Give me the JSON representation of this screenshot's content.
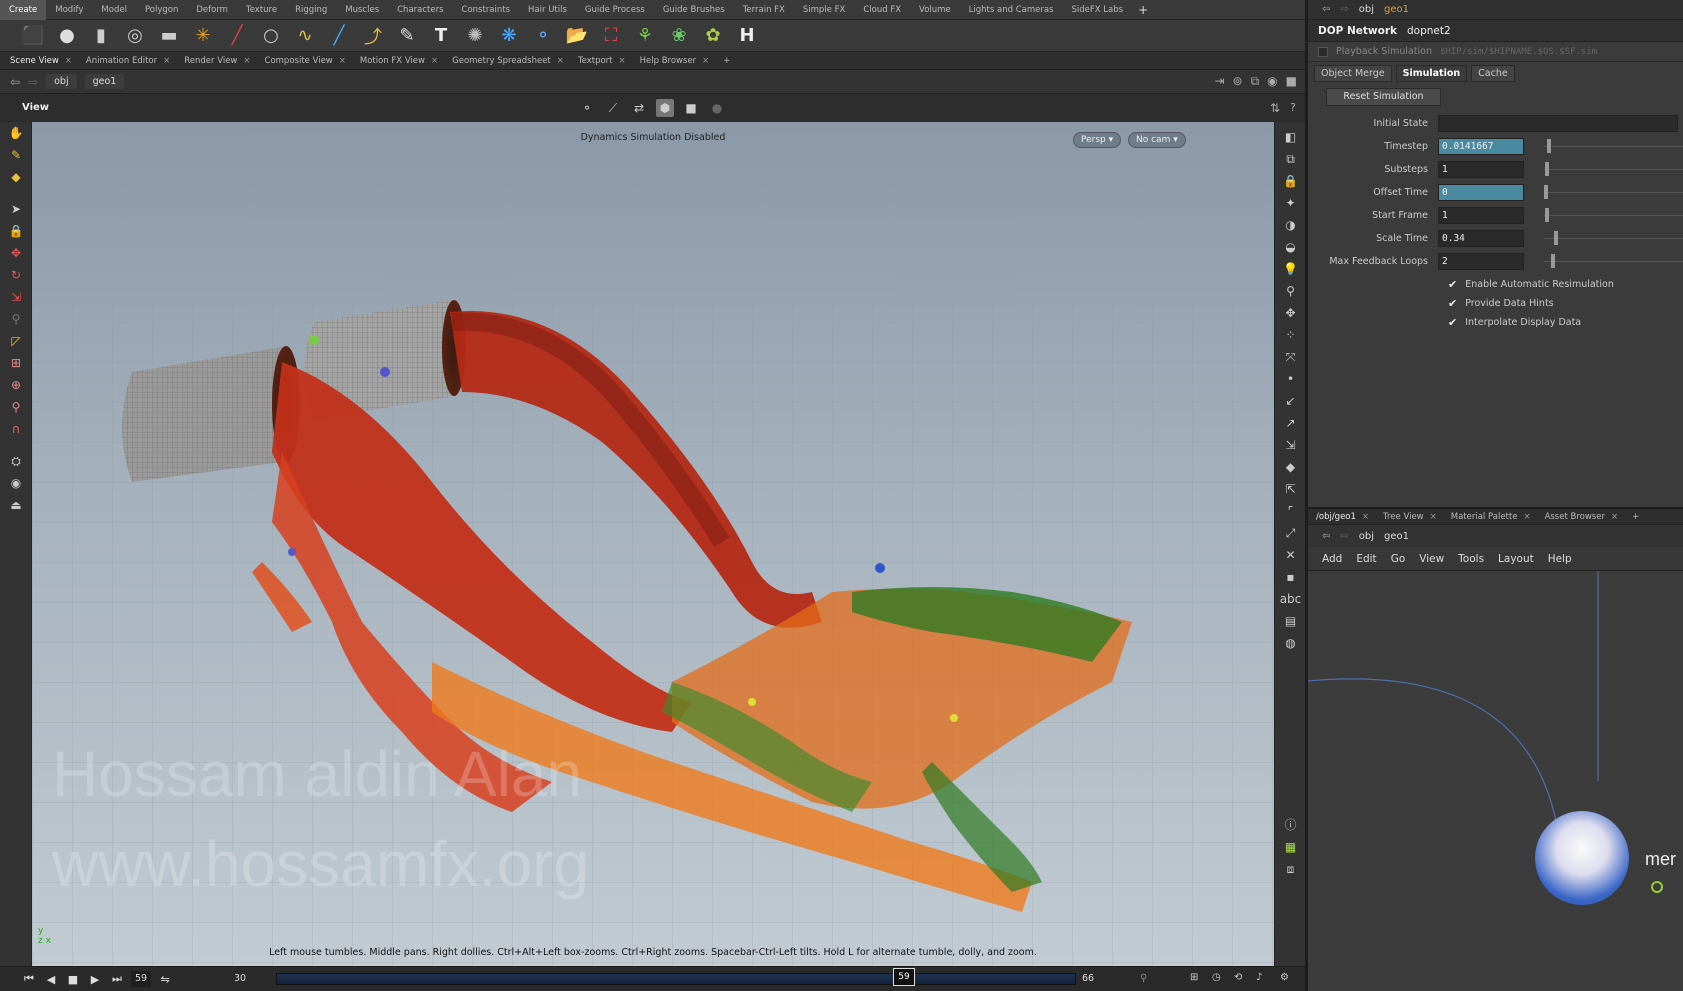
{
  "shelf": {
    "tabs": [
      "Create",
      "Modify",
      "Model",
      "Polygon",
      "Deform",
      "Texture",
      "Rigging",
      "Muscles",
      "Characters",
      "Constraints",
      "Hair Utils",
      "Guide Process",
      "Guide Brushes",
      "Terrain FX",
      "Simple FX",
      "Cloud FX",
      "Volume",
      "Lights and Cameras",
      "SideFX Labs"
    ],
    "add": "+"
  },
  "pane_tabs": [
    "Scene View",
    "Animation Editor",
    "Render View",
    "Composite View",
    "Motion FX View",
    "Geometry Spreadsheet",
    "Textport",
    "Help Browser"
  ],
  "pane_tab_close": "×",
  "pathbar": {
    "obj": "obj",
    "geo": "geo1"
  },
  "viewer": {
    "title": "View",
    "status": "Dynamics Simulation Disabled",
    "persp": "Persp ▾",
    "cam": "No cam ▾",
    "hint": "Left mouse tumbles. Middle pans. Right dollies. Ctrl+Alt+Left box-zooms. Ctrl+Right zooms. Spacebar-Ctrl-Left tilts. Hold L for alternate tumble, dolly, and zoom.",
    "watermark_line1": "Hossam aldin Alan",
    "watermark_line2": "www.hossamfx.org"
  },
  "timeline": {
    "current_frame_field": "59",
    "start": "30",
    "end": "66",
    "current_marker": "59"
  },
  "parm_panel": {
    "path_obj": "obj",
    "path_geo": "geo1",
    "node_type": "DOP Network",
    "node_name": "dopnet2",
    "playback_label": "Playback Simulation",
    "cache_path": "$HIP/sim/$HIPNAME.$OS.$SF.sim",
    "tabs": [
      "Object Merge",
      "Simulation",
      "Cache"
    ],
    "active_tab": "Simulation",
    "reset_button": "Reset Simulation",
    "parms": [
      {
        "label": "Initial State",
        "value": ""
      },
      {
        "label": "Timestep",
        "value": "0.0141667"
      },
      {
        "label": "Substeps",
        "value": "1"
      },
      {
        "label": "Offset Time",
        "value": "0"
      },
      {
        "label": "Start Frame",
        "value": "1"
      },
      {
        "label": "Scale Time",
        "value": "0.34"
      },
      {
        "label": "Max Feedback Loops",
        "value": "2"
      }
    ],
    "checks": [
      "Enable Automatic Resimulation",
      "Provide Data Hints",
      "Interpolate Display Data"
    ]
  },
  "network": {
    "tabs": [
      "/obj/geo1",
      "Tree View",
      "Material Palette",
      "Asset Browser"
    ],
    "add": "+",
    "path_obj": "obj",
    "path_geo": "geo1",
    "menu": [
      "Add",
      "Edit",
      "Go",
      "View",
      "Tools",
      "Layout",
      "Help"
    ],
    "node_label": "mer"
  },
  "colors": {
    "accent": "#4a8aa0",
    "timeline": "#1f3350",
    "sim_red": "#c2301a",
    "sim_orange": "#ef7a1c",
    "sim_green": "#2f7a22"
  }
}
